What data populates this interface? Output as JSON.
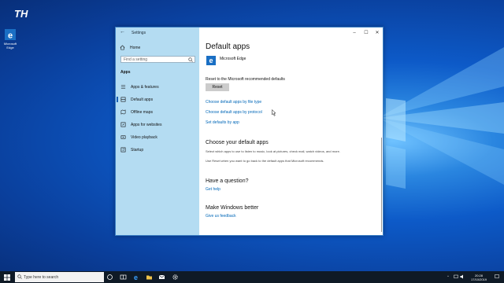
{
  "colors": {
    "accent": "#0067b8",
    "sidebar_bg": "#b4dcf2",
    "taskbar_bg": "#0f1a26",
    "desktop_bg": "#0a3f9c"
  },
  "desktop": {
    "watermark_logo": "TH",
    "icons": [
      {
        "label": "Microsoft Edge",
        "icon": "edge-icon"
      }
    ]
  },
  "window": {
    "title": "Settings",
    "back_icon": "back-arrow-icon",
    "controls": {
      "minimize": "–",
      "maximize": "☐",
      "close": "✕"
    }
  },
  "sidebar": {
    "home": "Home",
    "search_placeholder": "Find a setting",
    "section": "Apps",
    "items": [
      {
        "label": "Apps & features",
        "icon": "list-icon"
      },
      {
        "label": "Default apps",
        "icon": "default-apps-icon",
        "active": true
      },
      {
        "label": "Offline maps",
        "icon": "map-icon"
      },
      {
        "label": "Apps for websites",
        "icon": "link-icon"
      },
      {
        "label": "Video playback",
        "icon": "video-icon"
      },
      {
        "label": "Startup",
        "icon": "startup-icon"
      }
    ]
  },
  "main": {
    "title": "Default apps",
    "browser": {
      "name": "Microsoft Edge",
      "icon": "edge-icon"
    },
    "reset_label": "Reset to the Microsoft recommended defaults",
    "reset_button": "Reset",
    "links": [
      "Choose default apps by file type",
      "Choose default apps by protocol",
      "Set defaults by app"
    ],
    "choose": {
      "heading": "Choose your default apps",
      "text1": "Select which apps to use to listen to music, look at pictures, check mail, watch videos, and more.",
      "text2": "Use Reset when you want to go back to the default apps that Microsoft recommends."
    },
    "question": {
      "heading": "Have a question?",
      "link": "Get help"
    },
    "better": {
      "heading": "Make Windows better",
      "link": "Give us feedback"
    }
  },
  "taskbar": {
    "search_placeholder": "Type here to search",
    "pinned": [
      "cortana-icon",
      "task-view-icon",
      "edge-icon",
      "file-explorer-icon",
      "mail-icon",
      "settings-icon"
    ],
    "time": "20:28",
    "date": "17/10/2019"
  }
}
